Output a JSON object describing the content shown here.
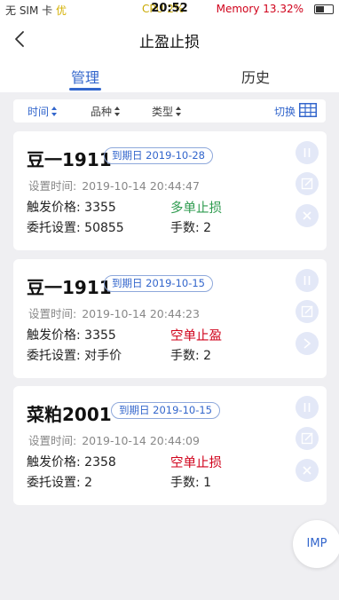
{
  "status_bar": {
    "carrier": "无 SIM 卡",
    "network": "优",
    "time": "20:52",
    "cpu": "CPU 2%",
    "memory": "Memory 13.32%"
  },
  "nav": {
    "title": "止盈止损"
  },
  "tabs": {
    "manage": "管理",
    "history": "历史"
  },
  "filters": {
    "time": "时间",
    "variety": "品种",
    "type": "类型",
    "switch": "切换"
  },
  "labels": {
    "set_time": "设置时间:",
    "trigger_price": "触发价格:",
    "entrust": "委托设置:",
    "hands": "手数:",
    "expiry_prefix": "到期日"
  },
  "orders": [
    {
      "name": "豆一1911",
      "expiry": "2019-10-28",
      "set_time": "2019-10-14 20:44:47",
      "trigger_price": "3355",
      "order_type": "多单止损",
      "entrust": "50855",
      "hands": "2",
      "type_color": "#2e9b4f"
    },
    {
      "name": "豆一1911",
      "expiry": "2019-10-15",
      "set_time": "2019-10-14 20:44:23",
      "trigger_price": "3355",
      "order_type": "空单止盈",
      "entrust": "对手价",
      "hands": "2",
      "type_color": "#d0021b"
    },
    {
      "name": "菜粕2001",
      "expiry": "2019-10-15",
      "set_time": "2019-10-14 20:44:09",
      "trigger_price": "2358",
      "order_type": "空单止损",
      "entrust": "2",
      "hands": "1",
      "type_color": "#d0021b"
    }
  ],
  "floating": {
    "imp": "IMP"
  },
  "icons": {
    "back": "chevron-left-icon",
    "table": "table-icon",
    "pause": "pause-icon",
    "edit": "edit-icon",
    "delete": "close-icon"
  },
  "colors": {
    "accent": "#3366cc",
    "loss_long": "#2e9b4f",
    "short": "#d0021b",
    "action_bg": "#e3e8f7"
  }
}
